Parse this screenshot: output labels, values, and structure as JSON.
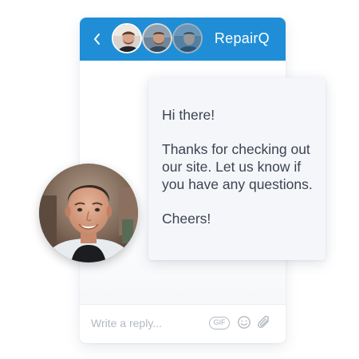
{
  "theme": {
    "accent": "#1f8ed6",
    "card_background": "#f4f6fa",
    "text_color": "#3c4350"
  },
  "header": {
    "brand_name": "RepairQ",
    "back_icon": "chevron-left-icon",
    "team_avatars": [
      {
        "name": "team-avatar-1"
      },
      {
        "name": "team-avatar-2"
      },
      {
        "name": "team-avatar-3"
      }
    ]
  },
  "message": {
    "greeting": "Hi there!",
    "body": "Thanks for checking out our site. Let us know if you have any questions.",
    "signoff": "Cheers!"
  },
  "composer": {
    "placeholder": "Write a reply...",
    "gif_label": "GIF",
    "emoji_icon": "smiley-icon",
    "attach_icon": "paperclip-icon"
  },
  "agent": {
    "photo": "agent-avatar"
  }
}
